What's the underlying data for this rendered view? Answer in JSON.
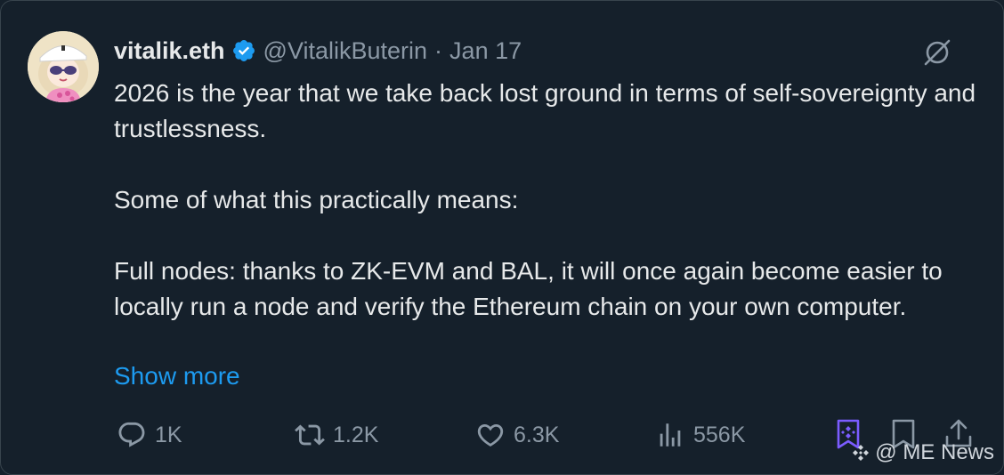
{
  "tweet": {
    "author_name": "vitalik.eth",
    "handle": "@VitalikButerin",
    "separator": "·",
    "date": "Jan 17",
    "paragraphs": [
      "2026 is the year that we take back lost ground in terms of self-sovereignty and trustlessness.",
      "Some of what this practically means:",
      "Full nodes: thanks to ZK-EVM and BAL, it will once again become easier to locally run a node and verify the Ethereum chain on your own computer."
    ],
    "show_more": "Show more",
    "verified": true
  },
  "actions": {
    "reply_count": "1K",
    "retweet_count": "1.2K",
    "like_count": "6.3K",
    "views_count": "556K"
  },
  "icons": {
    "reply": "reply-icon",
    "retweet": "retweet-icon",
    "like": "heart-icon",
    "views": "analytics-icon",
    "grok": "grok-icon",
    "bookmark": "bookmark-icon",
    "share": "share-icon",
    "binance": "binance-bookmark-icon"
  },
  "watermark": {
    "text": "@ ME News"
  },
  "colors": {
    "background": "#15202b",
    "text": "#e7e9ea",
    "muted": "#8b98a5",
    "link": "#1d9bf0",
    "verified": "#1d9bf0",
    "binance_accent": "#7b5cff"
  }
}
